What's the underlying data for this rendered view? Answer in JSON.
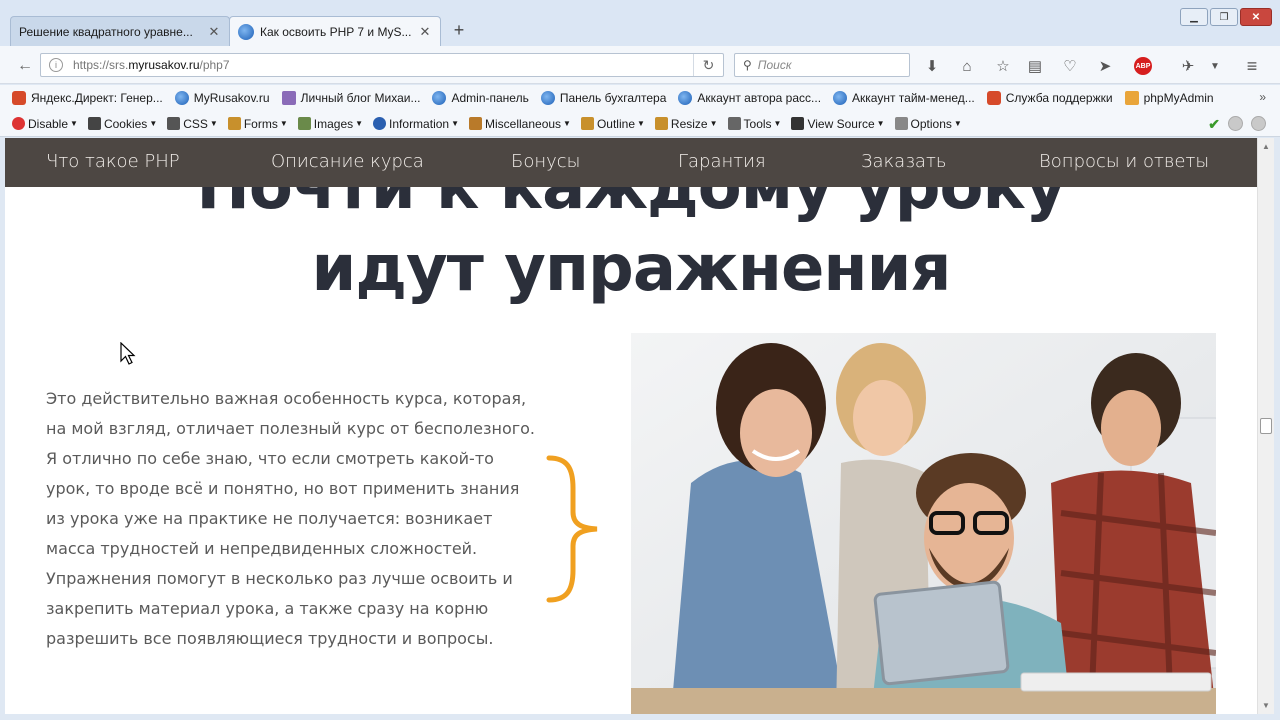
{
  "browser": {
    "tabs": [
      {
        "label": "Решение квадратного уравне...",
        "active": false
      },
      {
        "label": "Как освоить PHP 7 и MyS...",
        "active": true
      }
    ],
    "url_prefix": "https://srs.",
    "url_domain": "myrusakov.ru",
    "url_path": "/php7",
    "search_placeholder": "Поиск",
    "bookmarks": [
      {
        "label": "Яндекс.Директ: Генер...",
        "icon": "yandex-icon"
      },
      {
        "label": "MyRusakov.ru",
        "icon": "globe-icon"
      },
      {
        "label": "Личный блог Михаи...",
        "icon": "gmail-icon"
      },
      {
        "label": "Admin-панель",
        "icon": "globe-icon"
      },
      {
        "label": "Панель бухгалтера",
        "icon": "globe-icon"
      },
      {
        "label": "Аккаунт автора расс...",
        "icon": "globe-icon"
      },
      {
        "label": "Аккаунт тайм-менед...",
        "icon": "globe-icon"
      },
      {
        "label": "Служба поддержки",
        "icon": "support-icon"
      },
      {
        "label": "phpMyAdmin",
        "icon": "phpmyadmin-icon"
      }
    ],
    "devtools": [
      {
        "label": "Disable",
        "icon": "disable-icon"
      },
      {
        "label": "Cookies",
        "icon": "cookies-icon"
      },
      {
        "label": "CSS",
        "icon": "css-icon"
      },
      {
        "label": "Forms",
        "icon": "forms-icon"
      },
      {
        "label": "Images",
        "icon": "images-icon"
      },
      {
        "label": "Information",
        "icon": "information-icon"
      },
      {
        "label": "Miscellaneous",
        "icon": "miscellaneous-icon"
      },
      {
        "label": "Outline",
        "icon": "outline-icon"
      },
      {
        "label": "Resize",
        "icon": "resize-icon"
      },
      {
        "label": "Tools",
        "icon": "tools-icon"
      },
      {
        "label": "View Source",
        "icon": "view-source-icon"
      },
      {
        "label": "Options",
        "icon": "options-icon"
      }
    ]
  },
  "site": {
    "nav": [
      "Что такое PHP",
      "Описание курса",
      "Бонусы",
      "Гарантия",
      "Заказать",
      "Вопросы и ответы"
    ],
    "headline_line1": "Почти к каждому уроку",
    "headline_line2": "идут упражнения",
    "body_lines": [
      "Это действительно важная особенность курса, которая,",
      "на мой взгляд, отличает полезный курс от бесполезного.",
      "Я отлично по себе знаю, что если смотреть какой-то",
      "урок, то вроде всё и понятно, но вот применить знания",
      "из урока уже на практике не получается: возникает",
      "масса трудностей и непредвиденных сложностей.",
      "Упражнения помогут в несколько раз лучше освоить и",
      "закрепить материал урока, а также сразу на корню",
      "разрешить все появляющиеся трудности и вопросы."
    ],
    "accent_color": "#f0a020",
    "nav_bg_color": "#4d4743"
  }
}
